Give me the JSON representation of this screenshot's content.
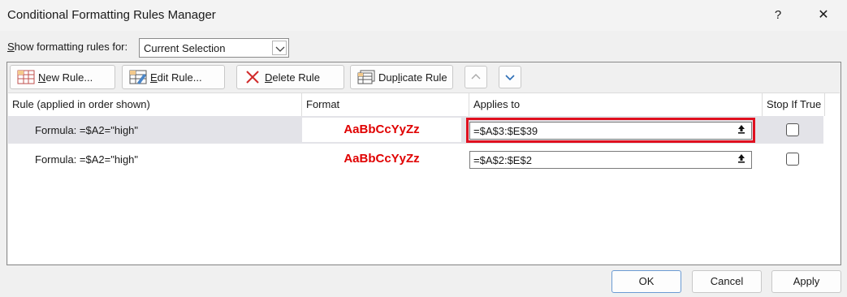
{
  "window": {
    "title": "Conditional Formatting Rules Manager",
    "help_glyph": "?",
    "close_glyph": "✕"
  },
  "filter": {
    "label_prefix": "S",
    "label_rest": "how formatting rules for:",
    "selected": "Current Selection"
  },
  "toolbar": {
    "new_rule": {
      "ul": "N",
      "rest": "ew Rule..."
    },
    "edit_rule": {
      "ul": "E",
      "rest": "dit Rule..."
    },
    "delete_rule": {
      "ul": "D",
      "rest": "elete Rule"
    },
    "duplicate_rule": {
      "pre": "Dup",
      "ul": "l",
      "rest": "icate Rule"
    }
  },
  "table": {
    "headers": [
      "Rule (applied in order shown)",
      "Format",
      "Applies to",
      "Stop If True"
    ],
    "rows": [
      {
        "rule": "Formula: =$A2=\"high\"",
        "format_preview": "AaBbCcYyZz",
        "applies_to": "=$A$3:$E$39",
        "stop_if_true": false,
        "selected": true
      },
      {
        "rule": "Formula: =$A2=\"high\"",
        "format_preview": "AaBbCcYyZz",
        "applies_to": "=$A$2:$E$2",
        "stop_if_true": false,
        "selected": false
      }
    ]
  },
  "buttons": {
    "ok": "OK",
    "cancel": "Cancel",
    "apply": "Apply"
  },
  "colors": {
    "highlight": "#e0101f",
    "format_text": "#e00000",
    "selected_row": "#e3e3e8"
  }
}
